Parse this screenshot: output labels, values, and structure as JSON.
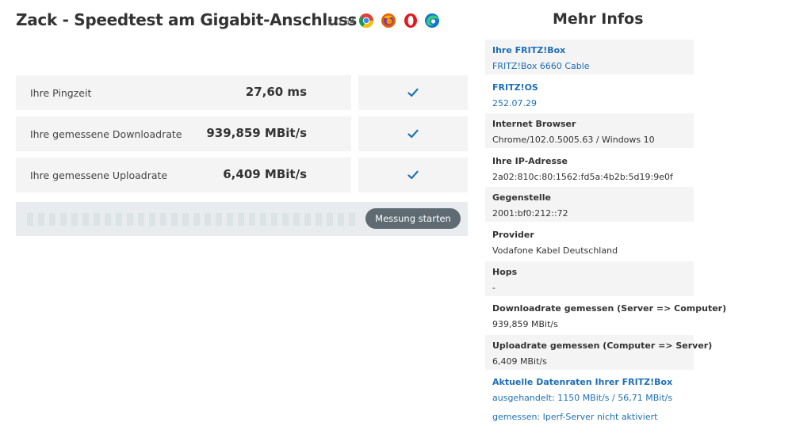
{
  "header": {
    "title": "Zack - Speedtest am Gigabit-Anschluss",
    "version": "2.0.54",
    "browser_icons": [
      "chrome-icon",
      "firefox-icon",
      "opera-icon",
      "edge-icon"
    ]
  },
  "results": [
    {
      "label": "Ihre Pingzeit",
      "value": "27,60 ms",
      "status": "check-icon"
    },
    {
      "label": "Ihre gemessene Downloadrate",
      "value": "939,859 MBit/s",
      "status": "check-icon"
    },
    {
      "label": "Ihre gemessene Uploadrate",
      "value": "6,409 MBit/s",
      "status": "check-icon"
    }
  ],
  "measure": {
    "button_label": "Messung starten",
    "progress": 0
  },
  "info": {
    "heading": "Mehr Infos",
    "items": [
      {
        "label": "Ihre FRITZ!Box",
        "value": "FRITZ!Box 6660 Cable"
      },
      {
        "label": "FRITZ!OS",
        "value": "252.07.29"
      },
      {
        "label": "Internet Browser",
        "value": "Chrome/102.0.5005.63 / Windows 10"
      },
      {
        "label": "Ihre IP-Adresse",
        "value": "2a02:810c:80:1562:fd5a:4b2b:5d19:9e0f"
      },
      {
        "label": "Gegenstelle",
        "value": "2001:bf0:212::72"
      },
      {
        "label": "Provider",
        "value": "Vodafone Kabel Deutschland"
      },
      {
        "label": "Hops",
        "value": "-"
      },
      {
        "label": "Downloadrate gemessen (Server => Computer)",
        "value": "939,859 MBit/s"
      },
      {
        "label": "Uploadrate gemessen (Computer => Server)",
        "value": "6,409 MBit/s"
      },
      {
        "label": "Aktuelle Datenraten Ihrer FRITZ!Box",
        "value": "ausgehandelt: 1150 MBit/s / 56,71 MBit/s",
        "value2": "gemessen: Iperf-Server nicht aktiviert"
      }
    ]
  },
  "colors": {
    "link": "#1e6fb5",
    "check": "#1e6fb5",
    "row_bg": "#f4f4f4",
    "button_bg": "#5f6b73"
  }
}
